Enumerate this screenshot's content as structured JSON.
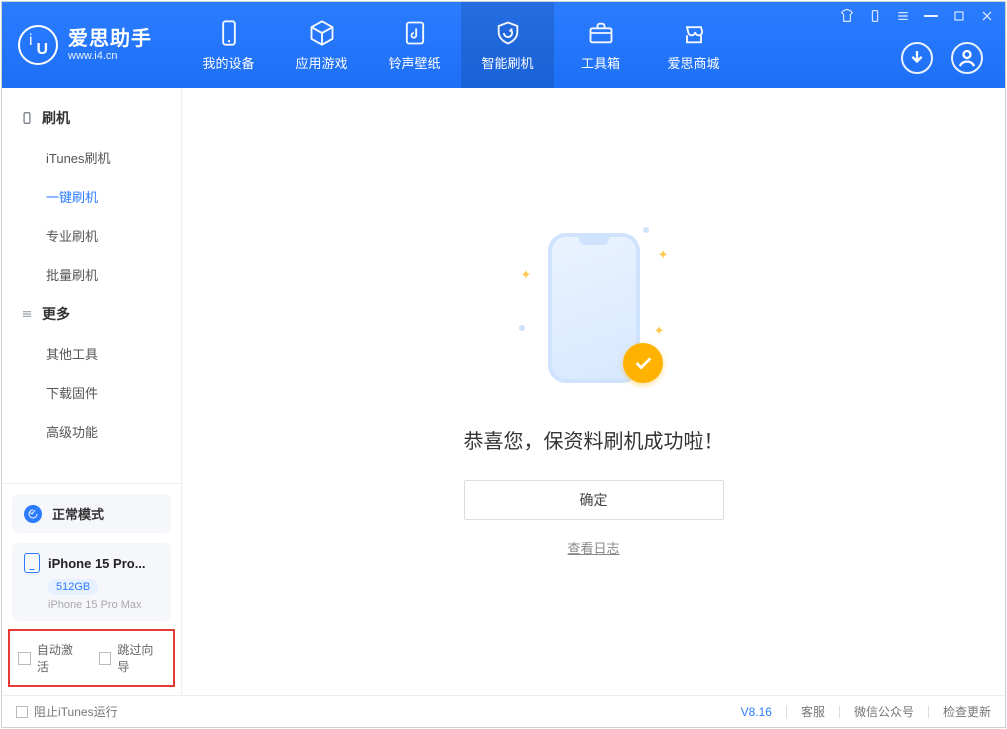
{
  "brand": {
    "name": "爱思助手",
    "url": "www.i4.cn"
  },
  "tabs": [
    {
      "label": "我的设备"
    },
    {
      "label": "应用游戏"
    },
    {
      "label": "铃声壁纸"
    },
    {
      "label": "智能刷机"
    },
    {
      "label": "工具箱"
    },
    {
      "label": "爱思商城"
    }
  ],
  "activeTab": 3,
  "sidebar": {
    "group1": {
      "title": "刷机",
      "items": [
        "iTunes刷机",
        "一键刷机",
        "专业刷机",
        "批量刷机"
      ],
      "active": 1
    },
    "group2": {
      "title": "更多",
      "items": [
        "其他工具",
        "下载固件",
        "高级功能"
      ]
    }
  },
  "mode": {
    "label": "正常模式"
  },
  "device": {
    "name": "iPhone 15 Pro...",
    "storage": "512GB",
    "full": "iPhone 15 Pro Max"
  },
  "checks": {
    "autoActivate": "自动激活",
    "skipGuide": "跳过向导"
  },
  "main": {
    "headline": "恭喜您，保资料刷机成功啦！",
    "ok": "确定",
    "viewLog": "查看日志"
  },
  "footer": {
    "blockItunes": "阻止iTunes运行",
    "version": "V8.16",
    "links": [
      "客服",
      "微信公众号",
      "检查更新"
    ]
  }
}
